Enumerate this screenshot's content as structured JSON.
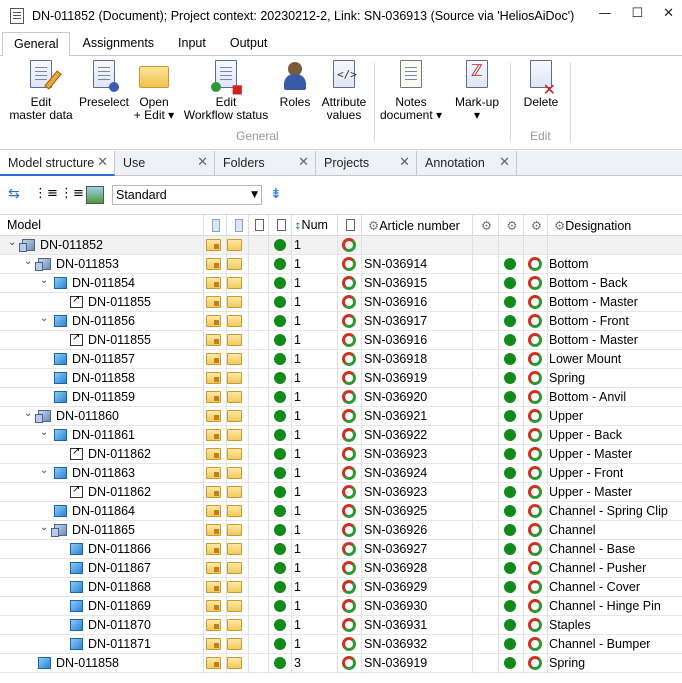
{
  "window": {
    "title": "DN-011852 (Document); Project context: 20230212-2, Link: SN-036913 (Source via 'HeliosAiDoc')",
    "buttons": [
      "—",
      "☐",
      "✕"
    ]
  },
  "ribbon_tabs": [
    "General",
    "Assignments",
    "Input",
    "Output"
  ],
  "ribbon": {
    "edit_master": "Edit\nmaster data",
    "preselect": "Preselect",
    "open_edit": "Open\n+ Edit ▾",
    "edit_workflow": "Edit\nWorkflow status",
    "roles": "Roles",
    "attribute_values": "Attribute\nvalues",
    "notes_document": "Notes\ndocument ▾",
    "markup": "Mark-up\n▾",
    "delete": "Delete",
    "group_general": "General",
    "group_edit": "Edit"
  },
  "panel_tabs": [
    "Model structure",
    "Use",
    "Folders",
    "Projects",
    "Annotation"
  ],
  "toolbar": {
    "view_select": "Standard"
  },
  "columns": {
    "model": "Model",
    "num": "Num",
    "article": "Article number",
    "designation": "Designation"
  },
  "rows": [
    {
      "label": "DN-011852",
      "num": "1",
      "article": "",
      "designation": ""
    },
    {
      "label": "DN-011853",
      "num": "1",
      "article": "SN-036914",
      "designation": "Bottom"
    },
    {
      "label": "DN-011854",
      "num": "1",
      "article": "SN-036915",
      "designation": "Bottom - Back"
    },
    {
      "label": "DN-011855",
      "num": "1",
      "article": "SN-036916",
      "designation": "Bottom - Master"
    },
    {
      "label": "DN-011856",
      "num": "1",
      "article": "SN-036917",
      "designation": "Bottom - Front"
    },
    {
      "label": "DN-011855",
      "num": "1",
      "article": "SN-036916",
      "designation": "Bottom - Master"
    },
    {
      "label": "DN-011857",
      "num": "1",
      "article": "SN-036918",
      "designation": "Lower Mount"
    },
    {
      "label": "DN-011858",
      "num": "1",
      "article": "SN-036919",
      "designation": "Spring"
    },
    {
      "label": "DN-011859",
      "num": "1",
      "article": "SN-036920",
      "designation": "Bottom - Anvil"
    },
    {
      "label": "DN-011860",
      "num": "1",
      "article": "SN-036921",
      "designation": "Upper"
    },
    {
      "label": "DN-011861",
      "num": "1",
      "article": "SN-036922",
      "designation": "Upper - Back"
    },
    {
      "label": "DN-011862",
      "num": "1",
      "article": "SN-036923",
      "designation": "Upper - Master"
    },
    {
      "label": "DN-011863",
      "num": "1",
      "article": "SN-036924",
      "designation": "Upper - Front"
    },
    {
      "label": "DN-011862",
      "num": "1",
      "article": "SN-036923",
      "designation": "Upper - Master"
    },
    {
      "label": "DN-011864",
      "num": "1",
      "article": "SN-036925",
      "designation": "Channel - Spring Clip"
    },
    {
      "label": "DN-011865",
      "num": "1",
      "article": "SN-036926",
      "designation": "Channel"
    },
    {
      "label": "DN-011866",
      "num": "1",
      "article": "SN-036927",
      "designation": "Channel - Base"
    },
    {
      "label": "DN-011867",
      "num": "1",
      "article": "SN-036928",
      "designation": "Channel - Pusher"
    },
    {
      "label": "DN-011868",
      "num": "1",
      "article": "SN-036929",
      "designation": "Channel - Cover"
    },
    {
      "label": "DN-011869",
      "num": "1",
      "article": "SN-036930",
      "designation": "Channel - Hinge Pin"
    },
    {
      "label": "DN-011870",
      "num": "1",
      "article": "SN-036931",
      "designation": "Staples"
    },
    {
      "label": "DN-011871",
      "num": "1",
      "article": "SN-036932",
      "designation": "Channel - Bumper"
    },
    {
      "label": "DN-011858",
      "num": "3",
      "article": "SN-036919",
      "designation": "Spring"
    }
  ]
}
